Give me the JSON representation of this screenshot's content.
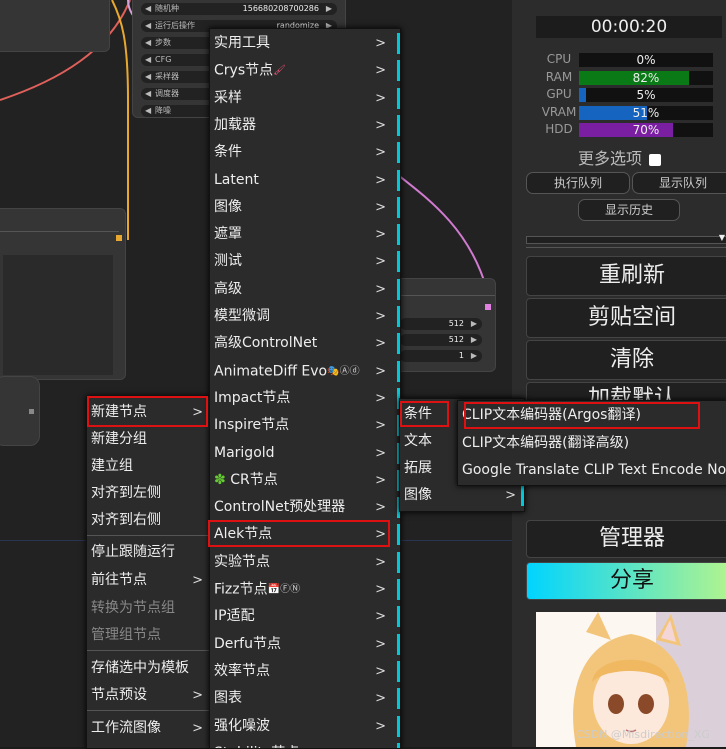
{
  "node_fields": [
    {
      "label": "随机种",
      "value": "156680208700286"
    },
    {
      "label": "运行后操作",
      "value": "randomize"
    },
    {
      "label": "步数",
      "value": ""
    },
    {
      "label": "CFG",
      "value": ""
    },
    {
      "label": "采样器",
      "value": ""
    },
    {
      "label": "调度器",
      "value": ""
    },
    {
      "label": "降噪",
      "value": ""
    }
  ],
  "node2_fields": [
    {
      "value": "512"
    },
    {
      "value": "512"
    },
    {
      "value": "1"
    }
  ],
  "panel": {
    "timer": "00:00:20",
    "stats": [
      {
        "label": "CPU",
        "value": "0%",
        "fraction": 0.0,
        "color": "#111111"
      },
      {
        "label": "RAM",
        "value": "82%",
        "fraction": 0.82,
        "color": "#0a7a16"
      },
      {
        "label": "GPU",
        "value": "5%",
        "fraction": 0.05,
        "color": "#1565c0"
      },
      {
        "label": "VRAM",
        "value": "51%",
        "fraction": 0.51,
        "color": "#1565c0"
      },
      {
        "label": "HDD",
        "value": "70%",
        "fraction": 0.7,
        "color": "#7b1fa2"
      }
    ],
    "more_options": "更多选项",
    "queue_exec": "执行队列",
    "queue_show": "显示队列",
    "history": "显示历史",
    "refresh": "重刷新",
    "clipspace": "剪贴空间",
    "clear": "清除",
    "load_default": "加载默认",
    "manager": "管理器",
    "share": "分享"
  },
  "context_menu": {
    "items": [
      {
        "label": "新建节点",
        "arrow": ">"
      },
      {
        "label": "新建分组",
        "arrow": ""
      },
      {
        "label": "建立组",
        "arrow": ""
      },
      {
        "label": "对齐到左侧",
        "arrow": ""
      },
      {
        "label": "对齐到右侧",
        "arrow": ""
      },
      {
        "label": "停止跟随运行",
        "arrow": ""
      },
      {
        "label": "前往节点",
        "arrow": ">"
      },
      {
        "label": "转换为节点组",
        "arrow": ""
      },
      {
        "label": "管理组节点",
        "arrow": ""
      },
      {
        "label": "存储选中为模板",
        "arrow": ""
      },
      {
        "label": "节点预设",
        "arrow": ">"
      },
      {
        "label": "工作流图像",
        "arrow": ">"
      }
    ]
  },
  "node_menu": {
    "items": [
      {
        "label": "实用工具"
      },
      {
        "label": "Crys节点"
      },
      {
        "label": "采样"
      },
      {
        "label": "加载器"
      },
      {
        "label": "条件"
      },
      {
        "label": "Latent"
      },
      {
        "label": "图像"
      },
      {
        "label": "遮罩"
      },
      {
        "label": "测试"
      },
      {
        "label": "高级"
      },
      {
        "label": "模型微调"
      },
      {
        "label": "高级ControlNet"
      },
      {
        "label": "AnimateDiff Evo"
      },
      {
        "label": "Impact节点"
      },
      {
        "label": "Inspire节点"
      },
      {
        "label": "Marigold"
      },
      {
        "label": "CR节点"
      },
      {
        "label": "ControlNet预处理器"
      },
      {
        "label": "Alek节点"
      },
      {
        "label": "实验节点"
      },
      {
        "label": "Fizz节点"
      },
      {
        "label": "IP适配"
      },
      {
        "label": "Derfu节点"
      },
      {
        "label": "效率节点"
      },
      {
        "label": "图表"
      },
      {
        "label": "强化噪波"
      },
      {
        "label": "Stability节点"
      }
    ],
    "arrow": ">"
  },
  "alek_menu": {
    "items": [
      {
        "label": "条件"
      },
      {
        "label": "文本"
      },
      {
        "label": "拓展"
      },
      {
        "label": "图像"
      }
    ]
  },
  "clip_menu": {
    "items": [
      {
        "label": "CLIP文本编码器(Argos翻译)"
      },
      {
        "label": "CLIP文本编码器(翻译高级)"
      },
      {
        "label": "Google Translate CLIP Text Encode Node"
      }
    ]
  },
  "watermark": "CSDN @Misdirection_XG",
  "colors": {
    "accent": "#00c8d8",
    "highlight": "#dd1111",
    "share_gradient_start": "#00d4ff",
    "share_gradient_end": "#b8f58a"
  }
}
